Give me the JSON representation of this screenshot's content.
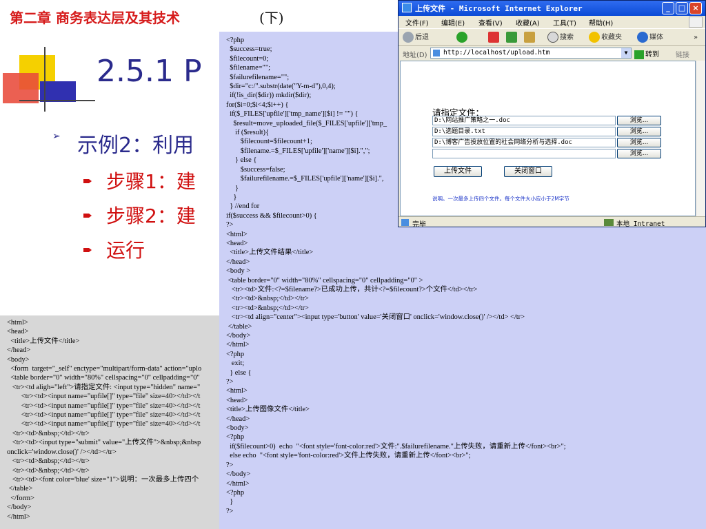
{
  "header": {
    "chapter_title": "第二章  商务表达层及其技术",
    "chapter_sub": "(下)"
  },
  "slide": {
    "heading": "2.5.1 P",
    "example": "示例2：利用",
    "steps": [
      "步骤1：建",
      "步骤2：建",
      "运行"
    ]
  },
  "code_left": "<html>\n<head>\n  <title>上传文件</title>\n</head>\n<body>\n  <form  target=\"_self\" enctype=\"multipart/form-data\" action=\"uplo\n  <table border=\"0\" width=\"80%\" cellspacing=\"0\" cellpadding=\"0\"\n   <tr><td aligh=\"left\">请指定文件: <input type=\"hidden\" name=\"\n        <tr><td><input name=\"upfile[]\" type=\"file\" size=40></td></t\n        <tr><td><input name=\"upfile[]\" type=\"file\" size=40></td></t\n        <tr><td><input name=\"upfile[]\" type=\"file\" size=40></td></t\n        <tr><td><input name=\"upfile[]\" type=\"file\" size=40></td></t\n   <tr><td>&nbsp;</td></tr>\n   <tr><td><input type=\"submit\" value=\"上传文件\">&nbsp;&nbsp\nonclick='window.close()' /></td></tr>\n   <tr><td>&nbsp;</td></tr>\n   <tr><td>&nbsp;</td></tr>\n   <tr><td><font color='blue' size=\"1\">说明：一次最多上传四个\n </table>\n  </form>\n</body>\n</html>",
  "code_right": "<?php\n  $success=true;\n  $filecount=0;\n  $filename=\"\";\n  $failurefilename=\"\";\n  $dir=\"c:/\".substr(date(\"Y-m-d\"),0,4);\n  if(!is_dir($dir)) mkdir($dir);\nfor($i=0;$i<4;$i++) {\n  if($_FILES['upfile']['tmp_name'][$i] != \"\") {\n    $result=move_uploaded_file($_FILES['upfile']['tmp_\n     if ($result){\n        $filecount=$filecount+1;\n        $filename.=$_FILES['upfile']['name'][$i].\",\";\n     } else {\n        $success=false;\n        $failurefilename.=$_FILES['upfile']['name'][$i].\",\n     }\n    }\n  } //end for\nif($success && $filecount>0) {\n?>\n<html>\n<head>\n  <title>上传文件结果</title>\n</head>\n<body >\n <table border=\"0\" width=\"80%\" cellspacing=\"0\" cellpadding=\"0\" >\n   <tr><td>文件:<?=$filename?>已成功上传，共计<?=$filecount?>个文件</td></tr>\n   <tr><td>&nbsp;</td></tr>\n   <tr><td>&nbsp;</td></tr>\n   <tr><td align=\"center\"><input type='button' value='关闭窗口' onclick='window.close()' /></td> </tr>\n </table>\n</body>\n</html>\n<?php\n   exit;\n  } else {\n?>\n<html>\n<head>\n<title>上传图像文件</title>\n</head>\n<body>\n<?php\n  if($filecount>0)  echo  \"<font style='font-color:red'>文件:\".$failurefilename.\"上传失败，请重新上传</font><br>\";\n  else echo  \"<font style='font-color:red'>文件上传失败，请重新上传</font><br>\";\n?>\n</body>\n</html>\n<?php\n  }\n?>",
  "ie": {
    "title": "上传文件 - Microsoft Internet Explorer",
    "window_buttons": [
      "_",
      "□",
      "×"
    ],
    "menu": [
      "文件(F)",
      "编辑(E)",
      "查看(V)",
      "收藏(A)",
      "工具(T)",
      "帮助(H)"
    ],
    "toolbar": {
      "back": "后退",
      "search": "搜索",
      "favorites": "收藏夹",
      "media": "媒体"
    },
    "address_label": "地址(D)",
    "address_value": "http://localhost/upload.htm",
    "go_label": "转到",
    "links_label": "链接",
    "more": "»",
    "page": {
      "prompt": "请指定文件：",
      "files": [
        "D:\\网站推广策略之一.doc",
        "D:\\选题目录.txt",
        "D:\\博客广告投放位置的社会网络分析与选择.doc",
        ""
      ],
      "browse_label": "浏览...",
      "upload_button": "上传文件",
      "close_button": "关闭窗口",
      "note": "说明。一次最多上传四个文件。每个文件大小应小于2M字节"
    },
    "status_left": "完毕",
    "status_zone": "本地 Intranet"
  },
  "colors": {
    "chapter_red": "#d61c1c",
    "heading_blue": "#2a2a8c",
    "left_panel": "#d7d7d7",
    "right_panel": "#ccd0f6",
    "ie_title": "#0b4bd6",
    "note_blue": "#1a33c8"
  }
}
